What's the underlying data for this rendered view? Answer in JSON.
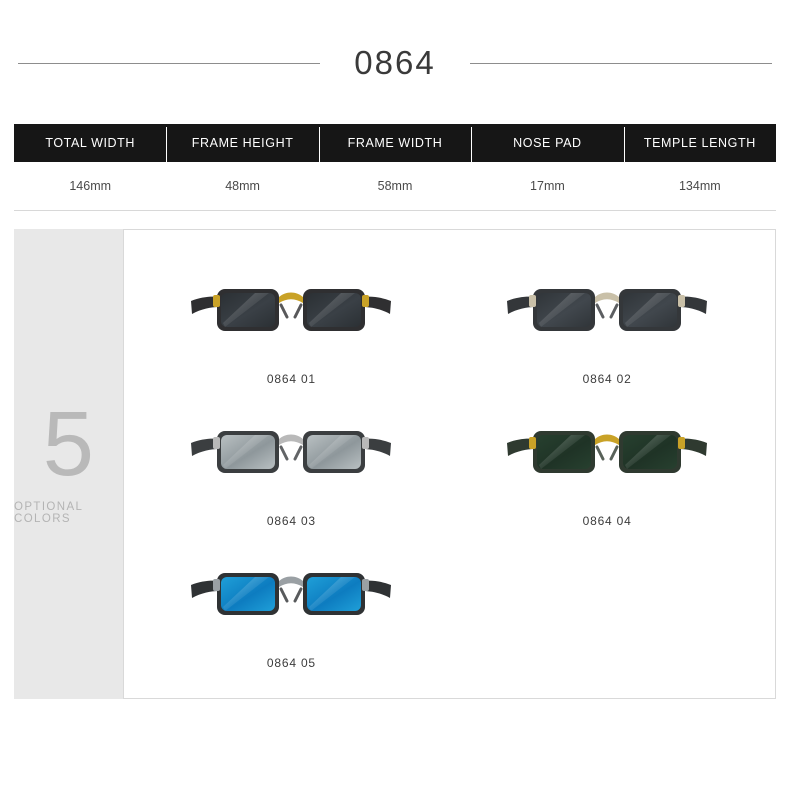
{
  "title": "0864",
  "spec_table": {
    "headers": [
      "TOTAL WIDTH",
      "FRAME HEIGHT",
      "FRAME WIDTH",
      "NOSE PAD",
      "TEMPLE LENGTH"
    ],
    "values": [
      "146mm",
      "48mm",
      "58mm",
      "17mm",
      "134mm"
    ]
  },
  "colors_badge": {
    "count": "5",
    "label": "OPTIONAL COLORS"
  },
  "variants": [
    {
      "caption": "0864  01",
      "lens": "#2b3034",
      "lens2": "#3a4046",
      "frame": "#2f2f31",
      "bridge": "#c9a227"
    },
    {
      "caption": "0864 02",
      "lens": "#303539",
      "lens2": "#41474d",
      "frame": "#34373a",
      "bridge": "#c9c0a8"
    },
    {
      "caption": "0864 03",
      "lens": "#b9c0c2",
      "lens2": "#8e979b",
      "frame": "#3b3e40",
      "bridge": "#b9b9b9"
    },
    {
      "caption": "0864  04",
      "lens": "#27402f",
      "lens2": "#1f3326",
      "frame": "#2f3a30",
      "bridge": "#c9a227"
    },
    {
      "caption": "0864  05",
      "lens": "#1f9fd8",
      "lens2": "#0d7cc0",
      "frame": "#2f3234",
      "bridge": "#9aa0a4"
    }
  ]
}
